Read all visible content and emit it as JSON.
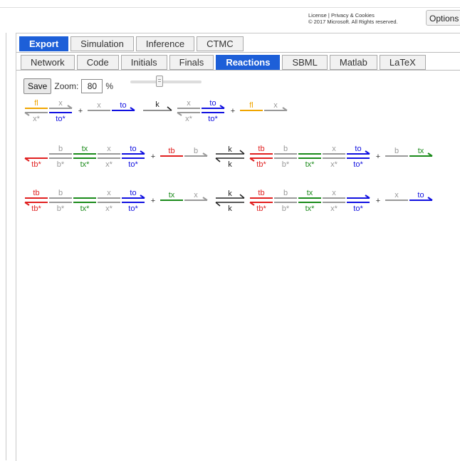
{
  "header": {
    "license_line1": "License | Privacy & Cookies",
    "license_line2": "© 2017 Microsoft. All Rights reserved.",
    "options_label": "Options"
  },
  "main_tabs": [
    "Export",
    "Simulation",
    "Inference",
    "CTMC"
  ],
  "main_tab_active": "Export",
  "sub_tabs": [
    "Network",
    "Code",
    "Initials",
    "Finals",
    "Reactions",
    "SBML",
    "Matlab",
    "LaTeX"
  ],
  "sub_tab_active": "Reactions",
  "toolbar": {
    "save_label": "Save",
    "zoom_label": "Zoom:",
    "zoom_value": "80",
    "zoom_unit": "%"
  },
  "colors": {
    "fl": "#f0a500",
    "tb": "#e02020",
    "tx": "#1a8a1a",
    "to": "#1010e0",
    "neutral": "#999999",
    "arrow": "#222222"
  },
  "reactions": [
    {
      "lhs": [
        {
          "top": [
            {
              "t": "fl",
              "c": "fl"
            },
            {
              "t": "x",
              "c": "neutral"
            }
          ],
          "bottom": [
            {
              "t": "x*",
              "c": "neutral"
            },
            {
              "t": "to*",
              "c": "to"
            }
          ],
          "arrow_top": true,
          "arrow_bottom_left": true
        },
        {
          "top": [
            {
              "t": "x",
              "c": "neutral"
            },
            {
              "t": "to",
              "c": "to"
            }
          ],
          "single": true
        }
      ],
      "arrow": "forward",
      "rate_forward": "k",
      "rhs": [
        {
          "top": [
            {
              "t": "x",
              "c": "neutral"
            },
            {
              "t": "to",
              "c": "to"
            }
          ],
          "bottom": [
            {
              "t": "x*",
              "c": "neutral"
            },
            {
              "t": "to*",
              "c": "to"
            }
          ]
        },
        {
          "top": [
            {
              "t": "fl",
              "c": "fl"
            },
            {
              "t": "x",
              "c": "neutral"
            }
          ],
          "single": true
        }
      ]
    },
    {
      "lhs": [
        {
          "top": [
            {
              "t": "b",
              "c": "neutral"
            },
            {
              "t": "tx",
              "c": "tx"
            },
            {
              "t": "x",
              "c": "neutral"
            },
            {
              "t": "to",
              "c": "to"
            }
          ],
          "bottom": [
            {
              "t": "tb*",
              "c": "tb"
            },
            {
              "t": "b*",
              "c": "neutral"
            },
            {
              "t": "tx*",
              "c": "tx"
            },
            {
              "t": "x*",
              "c": "neutral"
            },
            {
              "t": "to*",
              "c": "to"
            }
          ],
          "offset_top": 1
        },
        {
          "top": [
            {
              "t": "tb",
              "c": "tb"
            },
            {
              "t": "b",
              "c": "neutral"
            }
          ],
          "single": true
        }
      ],
      "arrow": "reversible",
      "rate_forward": "k",
      "rate_reverse": "k",
      "rhs": [
        {
          "top": [
            {
              "t": "tb",
              "c": "tb"
            },
            {
              "t": "b",
              "c": "neutral"
            },
            {
              "t": "",
              "c": "tx"
            },
            {
              "t": "x",
              "c": "neutral"
            },
            {
              "t": "to",
              "c": "to"
            }
          ],
          "bottom": [
            {
              "t": "tb*",
              "c": "tb"
            },
            {
              "t": "b*",
              "c": "neutral"
            },
            {
              "t": "tx*",
              "c": "tx"
            },
            {
              "t": "x*",
              "c": "neutral"
            },
            {
              "t": "to*",
              "c": "to"
            }
          ]
        },
        {
          "top": [
            {
              "t": "b",
              "c": "neutral"
            },
            {
              "t": "tx",
              "c": "tx"
            }
          ],
          "single": true
        }
      ]
    },
    {
      "lhs": [
        {
          "top": [
            {
              "t": "tb",
              "c": "tb"
            },
            {
              "t": "b",
              "c": "neutral"
            },
            {
              "t": "",
              "c": "tx"
            },
            {
              "t": "x",
              "c": "neutral"
            },
            {
              "t": "to",
              "c": "to"
            }
          ],
          "bottom": [
            {
              "t": "tb*",
              "c": "tb"
            },
            {
              "t": "b*",
              "c": "neutral"
            },
            {
              "t": "tx*",
              "c": "tx"
            },
            {
              "t": "x*",
              "c": "neutral"
            },
            {
              "t": "to*",
              "c": "to"
            }
          ]
        },
        {
          "top": [
            {
              "t": "tx",
              "c": "tx"
            },
            {
              "t": "x",
              "c": "neutral"
            }
          ],
          "single": true
        }
      ],
      "arrow": "reversible",
      "rate_forward": "k",
      "rate_reverse": "k",
      "rhs": [
        {
          "top": [
            {
              "t": "tb",
              "c": "tb"
            },
            {
              "t": "b",
              "c": "neutral"
            },
            {
              "t": "tx",
              "c": "tx"
            },
            {
              "t": "x",
              "c": "neutral"
            },
            {
              "t": "",
              "c": "to"
            }
          ],
          "bottom": [
            {
              "t": "tb*",
              "c": "tb"
            },
            {
              "t": "b*",
              "c": "neutral"
            },
            {
              "t": "tx*",
              "c": "tx"
            },
            {
              "t": "x*",
              "c": "neutral"
            },
            {
              "t": "to*",
              "c": "to"
            }
          ]
        },
        {
          "top": [
            {
              "t": "x",
              "c": "neutral"
            },
            {
              "t": "to",
              "c": "to"
            }
          ],
          "single": true
        }
      ]
    }
  ]
}
